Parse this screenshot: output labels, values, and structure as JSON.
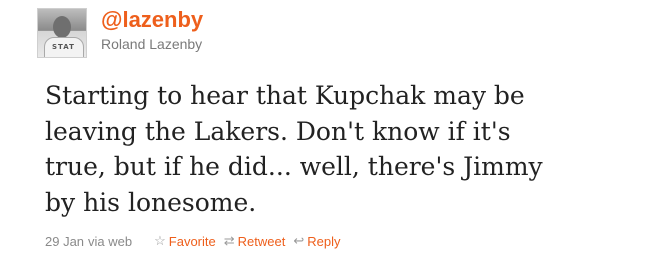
{
  "tweet": {
    "screen_name": "@lazenby",
    "real_name": "Roland Lazenby",
    "text": "Starting to hear that Kupchak may be leaving the Lakers. Don't know if it's true, but if he did... well, there's Jimmy by his lonesome.",
    "date": "29 Jan",
    "via": "via web",
    "avatar_letters": "STAT"
  },
  "actions": {
    "favorite": "Favorite",
    "retweet": "Retweet",
    "reply": "Reply"
  },
  "icons": {
    "favorite": "star-icon",
    "retweet": "retweet-icon",
    "reply": "reply-icon"
  },
  "colors": {
    "link": "#ee5f1c",
    "text": "#222222",
    "muted": "#8a8a8a"
  }
}
